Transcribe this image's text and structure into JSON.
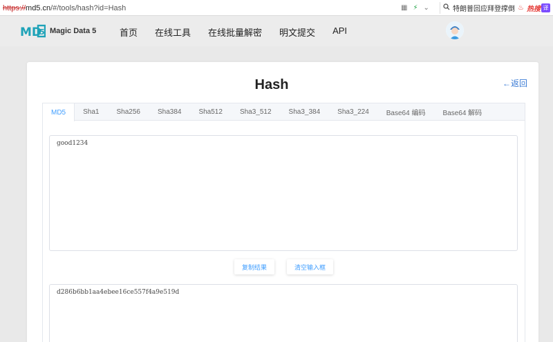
{
  "browser": {
    "url_scheme": "https://",
    "url_domain": "md5.cn",
    "url_path": "/#/tools/hash?id=Hash",
    "search_text": "特朗普回应拜登撑倒",
    "hot_label": "热搜",
    "translate_label": "译"
  },
  "header": {
    "logo_text": "Magic Data 5",
    "nav": [
      "首页",
      "在线工具",
      "在线批量解密",
      "明文提交",
      "API"
    ]
  },
  "page": {
    "title": "Hash",
    "back_label": "←返回"
  },
  "tabs": [
    "MD5",
    "Sha1",
    "Sha256",
    "Sha384",
    "Sha512",
    "Sha3_512",
    "Sha3_384",
    "Sha3_224",
    "Base64 编码",
    "Base64 解码"
  ],
  "active_tab": "MD5",
  "input_value": "good1234",
  "buttons": {
    "copy_label": "复制结果",
    "clear_label": "清空输入框"
  },
  "result_value": "d286b6bb1aa4ebee16ce557f4a9e519d",
  "colors": {
    "accent": "#409eff",
    "logo_teal": "#1fa3b8"
  }
}
